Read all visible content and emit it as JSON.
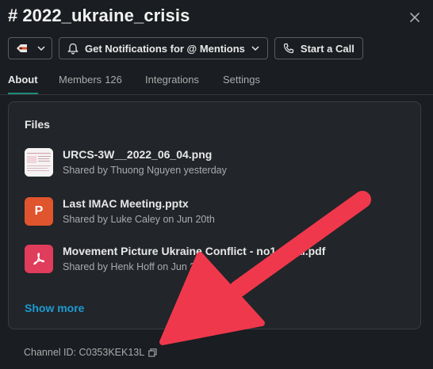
{
  "header": {
    "hash": "#",
    "channel_name": "2022_ukraine_crisis"
  },
  "toolbar": {
    "tag_icon": "tag-icon",
    "notifications_label": "Get Notifications for @ Mentions",
    "call_label": "Start a Call"
  },
  "tabs": [
    {
      "label": "About",
      "active": true
    },
    {
      "label": "Members",
      "count": "126"
    },
    {
      "label": "Integrations"
    },
    {
      "label": "Settings"
    }
  ],
  "files": {
    "title": "Files",
    "items": [
      {
        "name": "URCS-3W__2022_06_04.png",
        "meta": "Shared by Thuong Nguyen yesterday",
        "type": "png"
      },
      {
        "name": "Last IMAC Meeting.pptx",
        "meta": "Shared by Luke Caley on Jun 20th",
        "type": "pptx",
        "icon_letter": "P"
      },
      {
        "name": "Movement Picture Ukraine Conflict - no1_final.pdf",
        "meta": "Shared by Henk Hoff on Jun 20th",
        "type": "pdf"
      }
    ],
    "show_more": "Show more"
  },
  "footer": {
    "channel_id": "Channel ID: C0353KEK13L"
  },
  "colors": {
    "background": "#1a1d21",
    "card": "#222529",
    "accent_tab": "#1e8a7a",
    "link": "#1d9bd1",
    "annotation_arrow": "#f0384c"
  }
}
